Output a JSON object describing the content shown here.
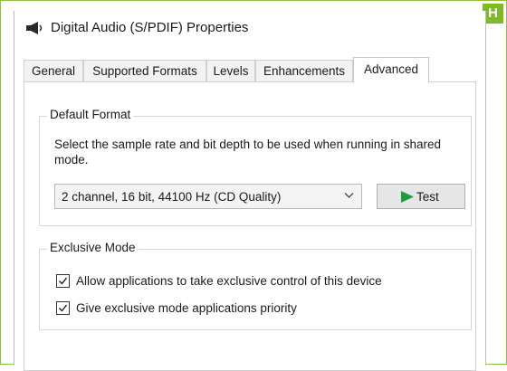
{
  "window": {
    "title": "Digital Audio (S/PDIF) Properties",
    "icon": "speaker-icon"
  },
  "corner_badge": {
    "label": "H",
    "color": "#7fb92a"
  },
  "tabs": [
    {
      "label": "General",
      "active": false
    },
    {
      "label": "Supported Formats",
      "active": false
    },
    {
      "label": "Levels",
      "active": false
    },
    {
      "label": "Enhancements",
      "active": false
    },
    {
      "label": "Advanced",
      "active": true
    }
  ],
  "default_format": {
    "legend": "Default Format",
    "description": "Select the sample rate and bit depth to be used when running in shared mode.",
    "selected_value": "2 channel, 16 bit, 44100 Hz (CD Quality)",
    "dropdown_icon": "chevron-down-icon",
    "test_button": {
      "label": "Test",
      "icon": "play-icon",
      "icon_color": "#1e9e3c"
    }
  },
  "exclusive_mode": {
    "legend": "Exclusive Mode",
    "options": [
      {
        "label": "Allow applications to take exclusive control of this device",
        "checked": true
      },
      {
        "label": "Give exclusive mode applications priority",
        "checked": true
      }
    ]
  }
}
